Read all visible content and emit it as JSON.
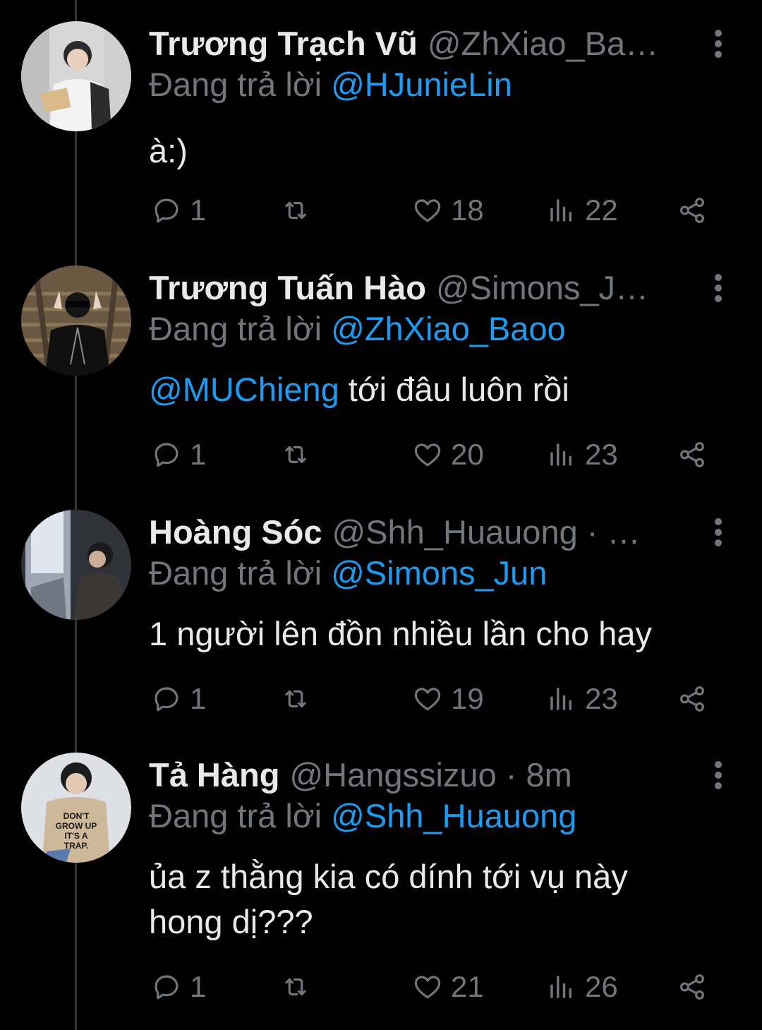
{
  "action_labels": {
    "reply": "reply",
    "retweet": "retweet",
    "like": "like",
    "views": "views",
    "share": "share"
  },
  "tweets": [
    {
      "display_name": "Trương Trạch Vũ",
      "handle": "@ZhXiao_Ba…",
      "reply_prefix": "Đang trả lời",
      "reply_to": "@HJunieLin",
      "text_mention": "",
      "text": "à:)",
      "counts": {
        "reply": "1",
        "like": "18",
        "views": "22"
      },
      "avatar_colors": {
        "bg": "#d9d9d9",
        "fg": "#222222",
        "accent": "#f2f2f2"
      }
    },
    {
      "display_name": "Trương Tuấn Hào",
      "handle": "@Simons_J…",
      "reply_prefix": "Đang trả lời",
      "reply_to": "@ZhXiao_Baoo",
      "text_mention": "@MUChieng",
      "text": " tới đâu luôn rồi",
      "counts": {
        "reply": "1",
        "like": "20",
        "views": "23"
      },
      "avatar_colors": {
        "bg": "#6b5a45",
        "fg": "#111111",
        "accent": "#a89275"
      }
    },
    {
      "display_name": "Hoàng Sóc",
      "handle": "@Shh_Huauong · …",
      "reply_prefix": "Đang trả lời",
      "reply_to": "@Simons_Jun",
      "text_mention": "",
      "text": "1 người lên đồn nhiều lần cho hay",
      "counts": {
        "reply": "1",
        "like": "19",
        "views": "23"
      },
      "avatar_colors": {
        "bg": "#3a3d44",
        "fg": "#1a1a1a",
        "accent": "#cfd6e0"
      }
    },
    {
      "display_name": "Tả Hàng",
      "handle": "@Hangssizuo · 8m",
      "reply_prefix": "Đang trả lời",
      "reply_to": "@Shh_Huauong",
      "text_mention": "",
      "text": "ủa z thằng kia có dính tới vụ này hong dị???",
      "counts": {
        "reply": "1",
        "like": "21",
        "views": "26"
      },
      "avatar_colors": {
        "bg": "#dfe3e8",
        "fg": "#1b1b1b",
        "accent": "#c9b79a"
      }
    }
  ],
  "avatar_sweater_text": "DON'T GROW UP IT'S A TRAP",
  "colors": {
    "background": "#000000",
    "primary_text": "#e7e9ea",
    "secondary_text": "#71767b",
    "accent": "#1d9bf0",
    "thread_line": "#333639"
  }
}
